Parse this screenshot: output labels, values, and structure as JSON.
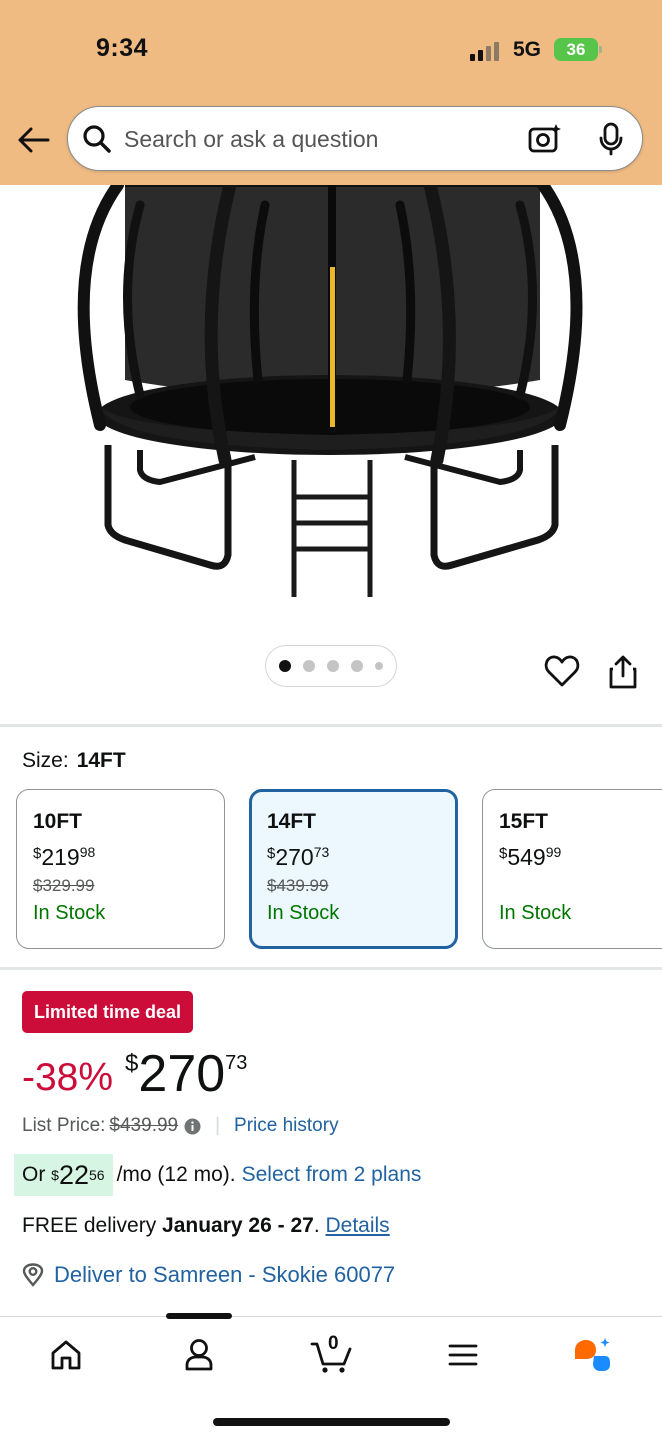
{
  "status_bar": {
    "time": "9:34",
    "network": "5G",
    "battery": "36"
  },
  "search": {
    "placeholder": "Search or ask a question"
  },
  "product": {
    "image_count": 5,
    "active_image": 1
  },
  "size": {
    "label": "Size:",
    "selected": "14FT",
    "options": [
      {
        "name": "10FT",
        "price_currency": "$",
        "price_whole": "219",
        "price_fraction": "98",
        "list_price": "$329.99",
        "stock": "In Stock"
      },
      {
        "name": "14FT",
        "price_currency": "$",
        "price_whole": "270",
        "price_fraction": "73",
        "list_price": "$439.99",
        "stock": "In Stock"
      },
      {
        "name": "15FT",
        "price_currency": "$",
        "price_whole": "549",
        "price_fraction": "99",
        "list_price": "",
        "stock": "In Stock"
      }
    ]
  },
  "deal": {
    "badge": "Limited time deal",
    "discount": "-38%",
    "price_currency": "$",
    "price_whole": "270",
    "price_fraction": "73",
    "list_label": "List Price:",
    "list_price": "$439.99",
    "price_history": "Price history"
  },
  "monthly": {
    "prefix": "Or ",
    "currency": "$",
    "amount_whole": "22",
    "amount_fraction": "56",
    "suffix": "/mo (12 mo).",
    "plans_link": "Select from 2 plans"
  },
  "delivery": {
    "prefix": "FREE delivery ",
    "dates": "January 26 - 27",
    "period": ". ",
    "details_link": "Details"
  },
  "location": {
    "text": "Deliver to Samreen - Skokie 60077"
  },
  "colors": {
    "header_bg": "#efbb83",
    "deal_red": "#cc0c39",
    "link_blue": "#2162a1",
    "stock_green": "#007600",
    "selected_border": "#2162a1"
  },
  "nav": {
    "items": [
      {
        "icon": "home-icon"
      },
      {
        "icon": "account-icon"
      },
      {
        "icon": "cart-icon",
        "count": "0"
      },
      {
        "icon": "menu-icon"
      },
      {
        "icon": "rufus-ai-icon"
      }
    ]
  }
}
